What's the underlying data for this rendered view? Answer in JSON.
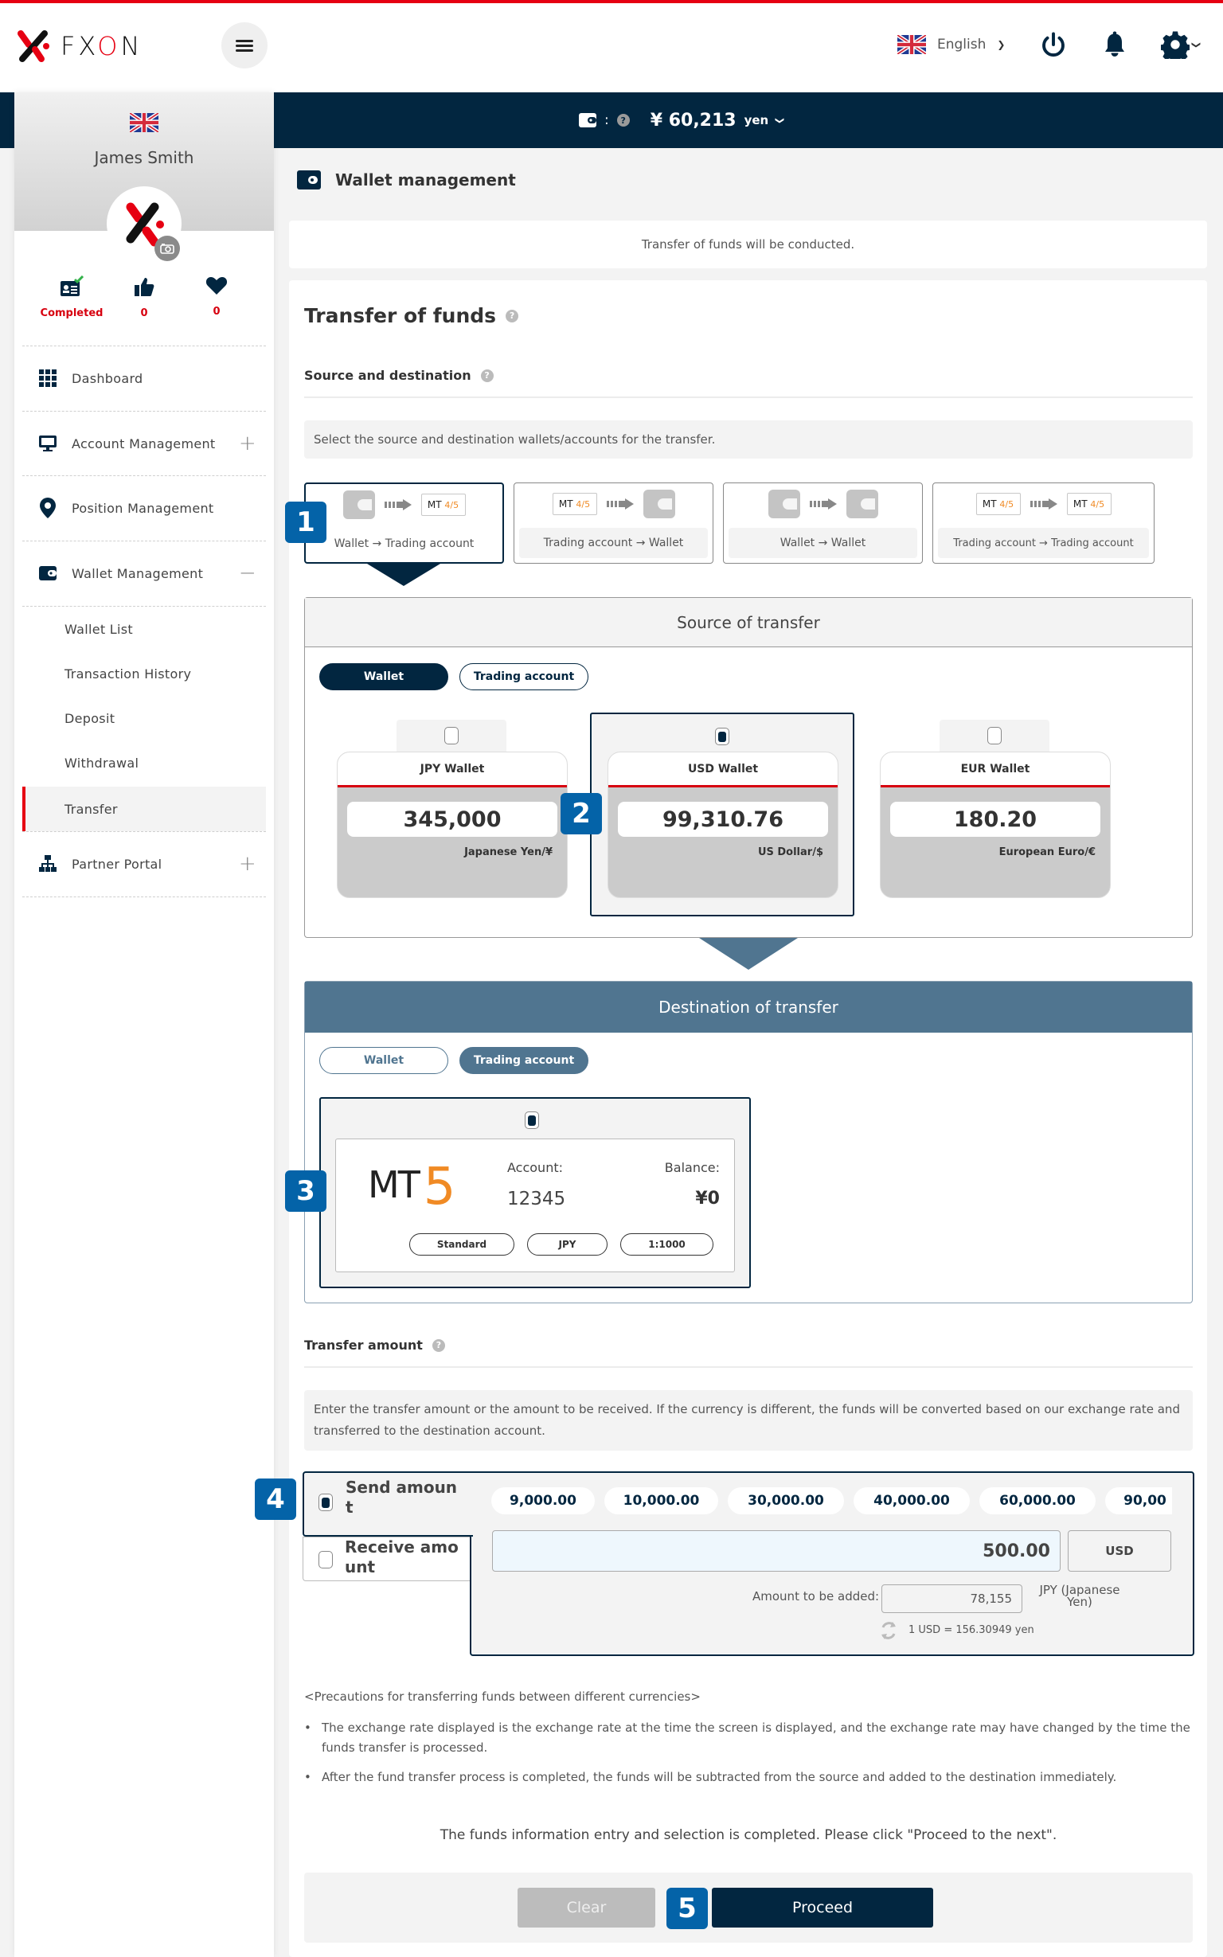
{
  "header": {
    "logo_text_prefix": "FX",
    "logo_text_o": "O",
    "logo_text_suffix": "N",
    "language": "English",
    "icons": [
      "power-icon",
      "bell-icon",
      "gear-icon"
    ]
  },
  "wallet_bar": {
    "separator": ":",
    "help": "?",
    "amount": "¥ 60,213",
    "unit": "yen"
  },
  "profile": {
    "name": "James Smith",
    "stats": [
      {
        "icon": "id-card-check-icon",
        "label": "Completed"
      },
      {
        "icon": "thumbs-up-icon",
        "label": "0"
      },
      {
        "icon": "heart-icon",
        "label": "0"
      }
    ]
  },
  "sidebar": {
    "items": [
      {
        "label": "Dashboard",
        "icon": "grid-icon",
        "toggle": ""
      },
      {
        "label": "Account Management",
        "icon": "monitor-icon",
        "toggle": "+"
      },
      {
        "label": "Position Management",
        "icon": "map-pin-icon",
        "toggle": ""
      },
      {
        "label": "Wallet Management",
        "icon": "wallet-icon",
        "toggle": "−"
      },
      {
        "label": "Partner Portal",
        "icon": "org-chart-icon",
        "toggle": "+"
      }
    ],
    "sub_items": [
      {
        "label": "Wallet List",
        "active": false
      },
      {
        "label": "Transaction History",
        "active": false
      },
      {
        "label": "Deposit",
        "active": false
      },
      {
        "label": "Withdrawal",
        "active": false
      },
      {
        "label": "Transfer",
        "active": true
      }
    ]
  },
  "page": {
    "title": "Wallet management",
    "info": "Transfer of funds will be conducted.",
    "section_title": "Transfer of funds",
    "help": "?"
  },
  "source_destination": {
    "title": "Source and destination",
    "note": "Select the source and destination wallets/accounts for the transfer.",
    "tiles": [
      {
        "label": "Wallet → Trading account",
        "from": "wallet",
        "to": "mt",
        "selected": true
      },
      {
        "label": "Trading account → Wallet",
        "from": "mt",
        "to": "wallet",
        "selected": false
      },
      {
        "label": "Wallet → Wallet",
        "from": "wallet",
        "to": "wallet",
        "selected": false
      },
      {
        "label": "Trading account → Trading account",
        "from": "mt",
        "to": "mt",
        "selected": false
      }
    ],
    "mt_icon": {
      "mt": "MT",
      "four": "4",
      "five": "5"
    }
  },
  "source": {
    "title": "Source of transfer",
    "tabs": [
      {
        "label": "Wallet",
        "active": true
      },
      {
        "label": "Trading account",
        "active": false
      }
    ],
    "wallets": [
      {
        "name": "JPY Wallet",
        "balance": "345,000",
        "currency": "Japanese Yen/¥",
        "selected": false
      },
      {
        "name": "USD Wallet",
        "balance": "99,310.76",
        "currency": "US Dollar/$",
        "selected": true
      },
      {
        "name": "EUR Wallet",
        "balance": "180.20",
        "currency": "European Euro/€",
        "selected": false
      }
    ]
  },
  "destination": {
    "title": "Destination of transfer",
    "tabs": [
      {
        "label": "Wallet",
        "active": false
      },
      {
        "label": "Trading account",
        "active": true
      }
    ],
    "account": {
      "platform": "MT",
      "platform_version": "5",
      "account_label": "Account:",
      "account_number": "12345",
      "balance_label": "Balance:",
      "balance": "¥0",
      "tags": [
        "Standard",
        "JPY",
        "1:1000"
      ],
      "selected": true
    }
  },
  "transfer_amount": {
    "title": "Transfer amount",
    "note": "Enter the transfer amount or the amount to be received. If the currency is different, the funds will be converted based on our exchange rate and transferred to the destination account.",
    "modes": [
      {
        "label": "Send amoun t",
        "checked": true
      },
      {
        "label": "Receive amo unt",
        "checked": false
      }
    ],
    "quick_amounts": [
      "9,000.00",
      "10,000.00",
      "30,000.00",
      "40,000.00",
      "60,000.00",
      "90,00"
    ],
    "amount_value": "500.00",
    "amount_currency": "USD",
    "added_label": "Amount to be added:",
    "added_value": "78,155",
    "added_currency": "JPY (Japanese Yen)",
    "rate": "1 USD = 156.30949 yen"
  },
  "precautions": {
    "title": "<Precautions for transferring funds between different currencies>",
    "items": [
      "The exchange rate displayed is the exchange rate at the time the screen is displayed, and the exchange rate may have changed by the time the funds transfer is processed.",
      "After the fund transfer process is completed, the funds will be subtracted from the source and added to the destination immediately."
    ]
  },
  "footer": {
    "message": "The funds information entry and selection is completed. Please click \"Proceed to the next\".",
    "clear_label": "Clear",
    "proceed_label": "Proceed"
  },
  "step_badges": [
    "1",
    "2",
    "3",
    "4",
    "5"
  ],
  "colors": {
    "brand_red": "#e60012",
    "navy": "#022640",
    "steel": "#507590",
    "badge_blue": "#0463a8",
    "mt_orange": "#f08a24"
  }
}
